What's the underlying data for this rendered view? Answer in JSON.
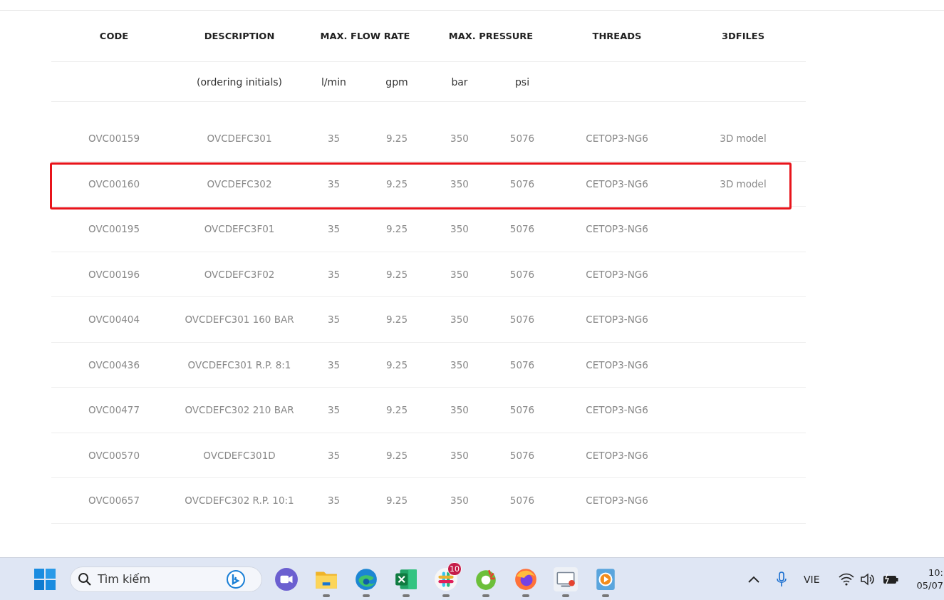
{
  "table": {
    "columns": [
      {
        "title": "CODE"
      },
      {
        "title": "DESCRIPTION",
        "unit": "(ordering initials)"
      },
      {
        "title": "MAX. FLOW RATE",
        "unit": "l/min"
      },
      {
        "unit": "gpm"
      },
      {
        "title": "MAX. PRESSURE",
        "unit": "bar"
      },
      {
        "unit": "psi"
      },
      {
        "title": "THREADS"
      },
      {
        "title": "3DFILES"
      }
    ],
    "rows": [
      {
        "cells": [
          "OVC00159",
          "OVCDEFC301",
          "35",
          "9.25",
          "350",
          "5076",
          "CETOP3-NG6",
          "3D model"
        ],
        "highlighted": false
      },
      {
        "cells": [
          "OVC00160",
          "OVCDEFC302",
          "35",
          "9.25",
          "350",
          "5076",
          "CETOP3-NG6",
          "3D model"
        ],
        "highlighted": true
      },
      {
        "cells": [
          "OVC00195",
          "OVCDEFC3F01",
          "35",
          "9.25",
          "350",
          "5076",
          "CETOP3-NG6"
        ],
        "highlighted": false
      },
      {
        "cells": [
          "OVC00196",
          "OVCDEFC3F02",
          "35",
          "9.25",
          "350",
          "5076",
          "CETOP3-NG6"
        ],
        "highlighted": false
      },
      {
        "cells": [
          "OVC00404",
          "OVCDEFC301 160 BAR",
          "35",
          "9.25",
          "350",
          "5076",
          "CETOP3-NG6"
        ],
        "highlighted": false
      },
      {
        "cells": [
          "OVC00436",
          "OVCDEFC301 R.P. 8:1",
          "35",
          "9.25",
          "350",
          "5076",
          "CETOP3-NG6"
        ],
        "highlighted": false
      },
      {
        "cells": [
          "OVC00477",
          "OVCDEFC302 210 BAR",
          "35",
          "9.25",
          "350",
          "5076",
          "CETOP3-NG6"
        ],
        "highlighted": false
      },
      {
        "cells": [
          "OVC00570",
          "OVCDEFC301D",
          "35",
          "9.25",
          "350",
          "5076",
          "CETOP3-NG6"
        ],
        "highlighted": false
      },
      {
        "cells": [
          "OVC00657",
          "OVCDEFC302 R.P. 10:1",
          "35",
          "9.25",
          "350",
          "5076",
          "CETOP3-NG6"
        ],
        "highlighted": false
      }
    ]
  },
  "taskbar": {
    "search": {
      "placeholder": "Tìm kiếm"
    },
    "apps": [
      {
        "kind": "chat",
        "running": false
      },
      {
        "kind": "folder",
        "running": true
      },
      {
        "kind": "edge",
        "running": true
      },
      {
        "kind": "excel",
        "running": true
      },
      {
        "kind": "slack",
        "running": true,
        "badge": "10"
      },
      {
        "kind": "coccoc",
        "running": true
      },
      {
        "kind": "firefox",
        "running": true
      },
      {
        "kind": "screen",
        "running": true
      },
      {
        "kind": "player",
        "running": true
      }
    ],
    "tray": {
      "language": "VIE",
      "time": "10:",
      "date": "05/07"
    }
  }
}
